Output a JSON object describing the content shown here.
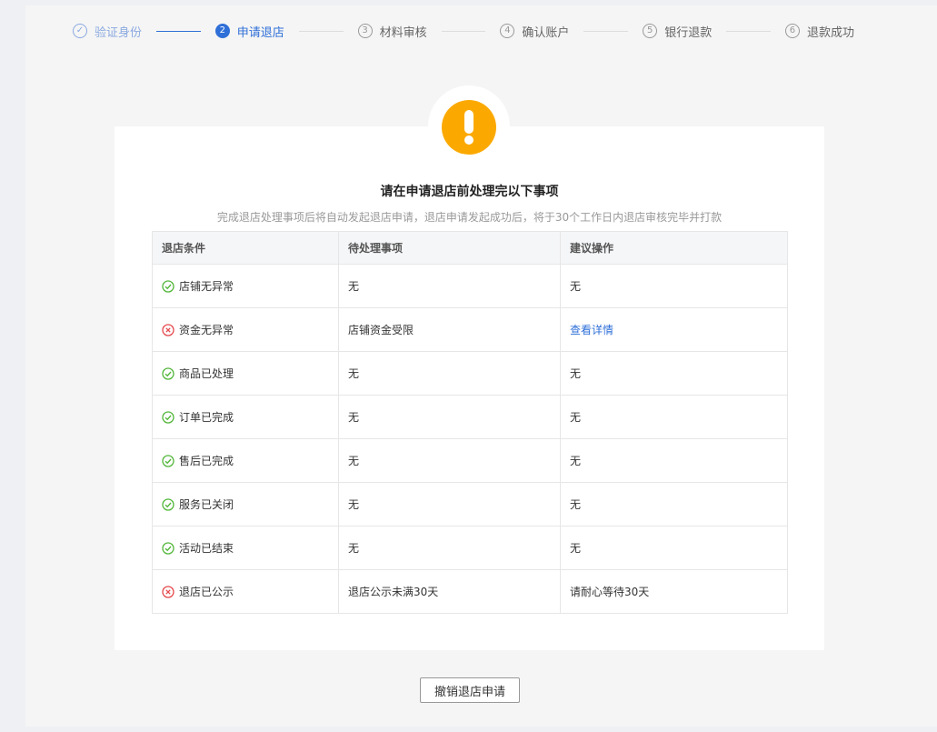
{
  "steps": [
    {
      "num": "✓",
      "label": "验证身份",
      "state": "done"
    },
    {
      "num": "2",
      "label": "申请退店",
      "state": "active"
    },
    {
      "num": "3",
      "label": "材料审核",
      "state": "todo"
    },
    {
      "num": "4",
      "label": "确认账户",
      "state": "todo"
    },
    {
      "num": "5",
      "label": "银行退款",
      "state": "todo"
    },
    {
      "num": "6",
      "label": "退款成功",
      "state": "todo"
    }
  ],
  "card": {
    "title": "请在申请退店前处理完以下事项",
    "subtitle": "完成退店处理事项后将自动发起退店申请，退店申请发起成功后，将于30个工作日内退店审核完毕并打款"
  },
  "table": {
    "headers": [
      "退店条件",
      "待处理事项",
      "建议操作"
    ],
    "rows": [
      {
        "status": "ok",
        "condition": "店铺无异常",
        "pending": "无",
        "action": "无",
        "action_link": false
      },
      {
        "status": "fail",
        "condition": "资金无异常",
        "pending": "店铺资金受限",
        "action": "查看详情",
        "action_link": true
      },
      {
        "status": "ok",
        "condition": "商品已处理",
        "pending": "无",
        "action": "无",
        "action_link": false
      },
      {
        "status": "ok",
        "condition": "订单已完成",
        "pending": "无",
        "action": "无",
        "action_link": false
      },
      {
        "status": "ok",
        "condition": "售后已完成",
        "pending": "无",
        "action": "无",
        "action_link": false
      },
      {
        "status": "ok",
        "condition": "服务已关闭",
        "pending": "无",
        "action": "无",
        "action_link": false
      },
      {
        "status": "ok",
        "condition": "活动已结束",
        "pending": "无",
        "action": "无",
        "action_link": false
      },
      {
        "status": "fail",
        "condition": "退店已公示",
        "pending": "退店公示未满30天",
        "action": "请耐心等待30天",
        "action_link": false
      }
    ]
  },
  "buttons": {
    "cancel_label": "撤销退店申请"
  },
  "colors": {
    "accent": "#2f6fd8",
    "ok": "#52b63a",
    "fail": "#e5484d",
    "warning": "#fba900"
  }
}
